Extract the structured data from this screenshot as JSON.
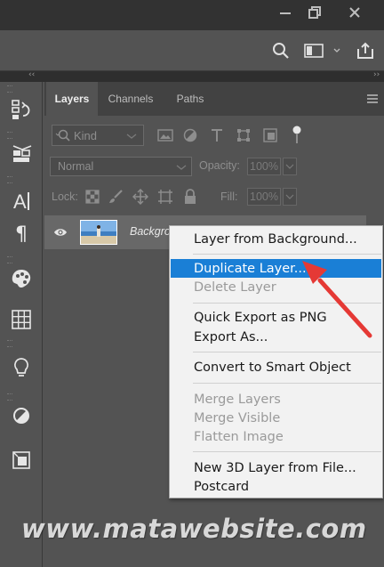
{
  "panel": {
    "tabs": [
      {
        "label": "Layers",
        "active": true
      },
      {
        "label": "Channels",
        "active": false
      },
      {
        "label": "Paths",
        "active": false
      }
    ],
    "filter_kind": "Kind",
    "blend_mode": "Normal",
    "opacity_label": "Opacity:",
    "opacity_value": "100%",
    "lock_label": "Lock:",
    "fill_label": "Fill:",
    "fill_value": "100%",
    "layer_name": "Backgro"
  },
  "context_menu": {
    "items": [
      {
        "label": "Layer from Background...",
        "enabled": true
      },
      {
        "label": "Duplicate Layer...",
        "enabled": true,
        "highlighted": true
      },
      {
        "label": "Delete Layer",
        "enabled": false
      },
      {
        "label": "Quick Export as PNG",
        "enabled": true
      },
      {
        "label": "Export As...",
        "enabled": true
      },
      {
        "label": "Convert to Smart Object",
        "enabled": true
      },
      {
        "label": "Merge Layers",
        "enabled": false
      },
      {
        "label": "Merge Visible",
        "enabled": false
      },
      {
        "label": "Flatten Image",
        "enabled": false
      },
      {
        "label": "New 3D Layer from File...",
        "enabled": true
      },
      {
        "label": "Postcard",
        "enabled": true
      }
    ]
  },
  "watermark": "www.matawebsite.com",
  "colors": {
    "app_bg": "#535353",
    "menu_highlight": "#1a7fd6",
    "arrow": "#e53935"
  },
  "icons": {
    "titlebar": [
      "minimize-icon",
      "restore-icon",
      "close-icon"
    ],
    "options_bar": [
      "search-icon",
      "workspace-icon",
      "share-icon"
    ],
    "tool_strip": [
      "history-icon",
      "properties-icon",
      "character-icon",
      "paragraph-icon",
      "color-palette-icon",
      "swatches-grid-icon",
      "learn-bulb-icon",
      "adjustments-icon",
      "libraries-icon"
    ]
  }
}
